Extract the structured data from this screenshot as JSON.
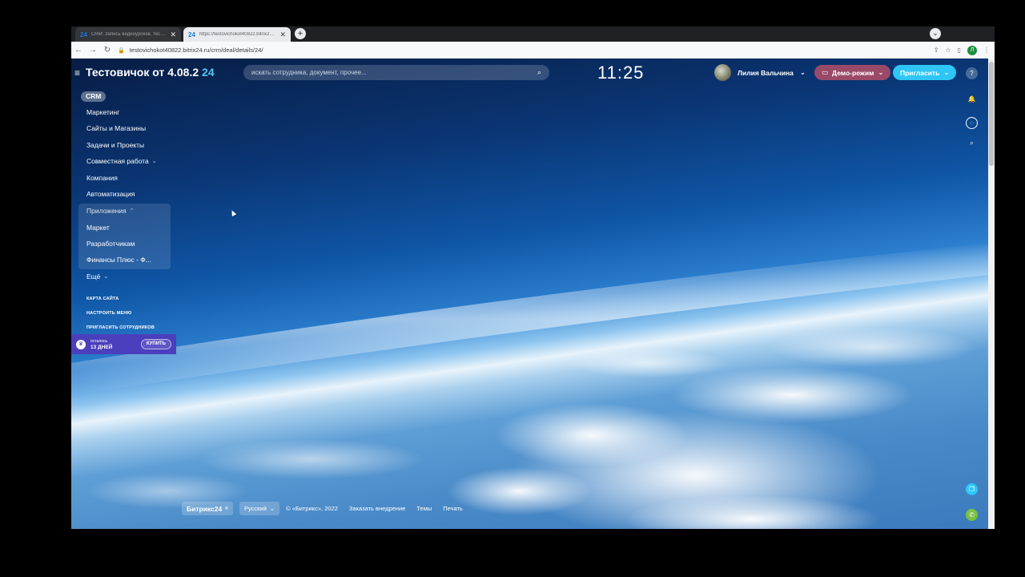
{
  "browser": {
    "tabs": [
      {
        "favicon": "24",
        "title": "CRM: Запись видеоуроков, тестеры"
      },
      {
        "favicon": "24",
        "title": "https://testovichokot40822.bitrix24.ru/"
      }
    ],
    "new_tab_label": "+",
    "url": "testovichokot40822.bitrix24.ru/crm/deal/details/24/",
    "profile_initial": "Л"
  },
  "header": {
    "portal_title": "Тестовичок от 4.08.2",
    "portal_title_suffix": "24",
    "search_placeholder": "искать сотрудника, документ, прочее...",
    "clock": "11:25",
    "user_name": "Лилия Вальчина",
    "demo_label": "Демо-режим",
    "invite_label": "Пригласить"
  },
  "sidebar": {
    "active_chip": "CRM",
    "items": [
      {
        "label": "Маркетинг"
      },
      {
        "label": "Сайты и Магазины"
      },
      {
        "label": "Задачи и Проекты"
      },
      {
        "label": "Совместная работа",
        "chevron": "⌄"
      },
      {
        "label": "Компания"
      },
      {
        "label": "Автоматизация"
      }
    ],
    "apps_group": {
      "label": "Приложения",
      "chevron": "⌃",
      "items": [
        {
          "label": "Маркет"
        },
        {
          "label": "Разработчикам"
        },
        {
          "label": "Финансы Плюс - Ф..."
        }
      ]
    },
    "more_label": "Ещё",
    "more_chevron": "⌄",
    "small_links": [
      {
        "label": "КАРТА САЙТА"
      },
      {
        "label": "НАСТРОИТЬ МЕНЮ"
      },
      {
        "label": "ПРИГЛАСИТЬ СОТРУДНИКОВ"
      }
    ],
    "trial": {
      "line1": "осталось",
      "line2": "13 ДНЕЙ",
      "buy_label": "КУПИТЬ"
    }
  },
  "footer": {
    "logo": "Битрикс24",
    "logo_sup": "©",
    "language": "Русский",
    "copyright": "© «Битрикс», 2022",
    "links": [
      {
        "label": "Заказать внедрение"
      },
      {
        "label": "Темы"
      },
      {
        "label": "Печать"
      }
    ]
  },
  "colors": {
    "demo": "#9a4a68",
    "invite": "#2fc6f6",
    "trial": "#4b3fbd",
    "accent_24": "#53c6f3"
  }
}
